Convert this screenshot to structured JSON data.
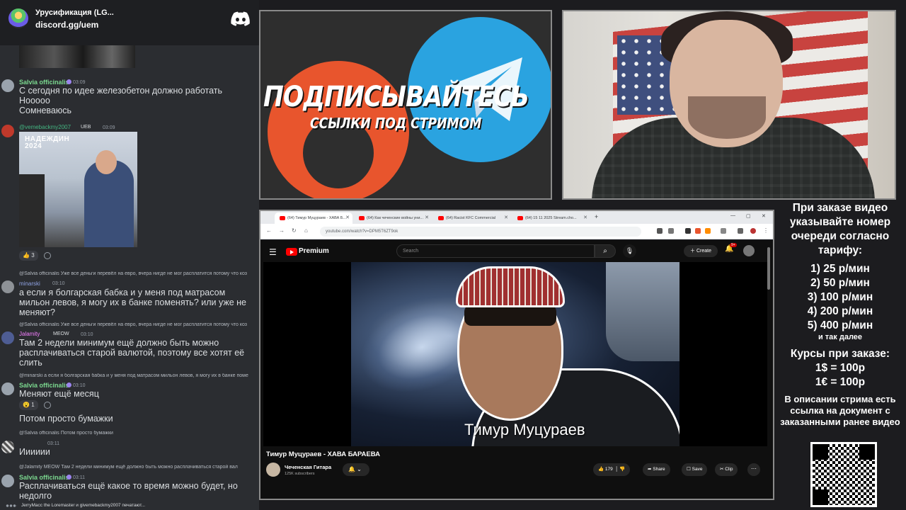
{
  "chat": {
    "server_name": "Урусификация (LG...",
    "invite": "discord.gg/uem",
    "messages": [
      {
        "user": "Salvia officinalis",
        "time": "03:09",
        "lines": "С сегодня по идее железобетон должно работать\nНооооо\nСомневаюсь",
        "color": "#7bd88f"
      },
      {
        "user": "@vemebackmy2007",
        "tag": "UEB",
        "time": "03:09",
        "color": "#43b581"
      },
      {
        "image_caption": "НАДЕЖДИН\n2024",
        "reaction": "3"
      },
      {
        "reply": "@Salvia officinalis Уже все деньги перевёл на евро, вчера нигде не мог расплатится потому что коз",
        "user": "minarski",
        "time": "03:10",
        "lines": "а если я болгарская бабка и у меня под матрасом\nмильон левов, я могу их в банке поменять? или уже не\nменяют?",
        "color": "#5865f2"
      },
      {
        "reply": "@Salvia officinalis Уже все деньги перевёл на евро, вчера нигде не мог расплатится потому что коз",
        "user": "Jalamity",
        "tag": "MEOW",
        "time": "03:10",
        "lines": "Там 2 недели минимум ещё должно быть можно\nрасплачиваться старой валютой, поэтому все хотят её\nслить",
        "color": "#f47fff"
      },
      {
        "reply": "@minarski а если я болгарская бабка и у меня под матрасом мильон левов, я могу их в банке поме",
        "user": "Salvia officinalis",
        "time": "03:10",
        "lines": "Меняют ещё месяц",
        "reaction": "1",
        "extra": "Потом просто бумажки",
        "color": "#7bd88f"
      },
      {
        "reply": "@Salvia officinalis Потом просто бумажки",
        "time": "03:11",
        "lines": "Ииииии"
      },
      {
        "reply": "@Jalamity MEOW Там 2 недели минимум ещё должно быть можно расплачиваться старой вал",
        "user": "Salvia officinalis",
        "time": "03:11",
        "lines": "Расплачиваться ещё какое то время можно будет, но\nнедолго",
        "color": "#7bd88f"
      }
    ],
    "typing": "JerryMacc the Loremaster и givemebackmy2007 печатают..."
  },
  "promo": {
    "title": "ПОДПИСЫВАЙТЕСЬ",
    "subtitle": "ССЫЛКИ ПОД СТРИМОМ"
  },
  "browser": {
    "tabs": [
      {
        "label": "(64) Тимур Муцураев - ХАВА Б..."
      },
      {
        "label": "(64) Как чеченские войны уни..."
      },
      {
        "label": "(64) Racist KFC Commercial"
      },
      {
        "label": "(64) 15 11 2025 Stream.cho..."
      }
    ],
    "url": "youtube.com/watch?v=DPM5T6ZT9ok"
  },
  "youtube": {
    "brand": "Premium",
    "search_placeholder": "Search",
    "create_label": "Create",
    "notif_count": "9+",
    "video_caption": "Тимур Муцураев",
    "video_title": "Тимур Муцураев - ХАВА БАРАЕВА",
    "channel_name": "Чеченская Гитара",
    "channel_subs": "125K subscribers",
    "likes": "179",
    "share_label": "Share",
    "save_label": "Save",
    "clip_label": "Clip"
  },
  "prices": {
    "intro": "При заказе видео указывайте номер очереди согласно тарифу:",
    "rates": [
      "1) 25 р/мин",
      "2) 50 р/мин",
      "3) 100 р/мин",
      "4) 200 р/мин",
      "5) 400 р/мин"
    ],
    "etc": "и так далее",
    "courses_title": "Курсы при заказе:",
    "course_usd": "1$ = 100р",
    "course_eur": "1€ = 100р",
    "description": "В описании стрима есть ссылка на документ с заказанными ранее видео"
  },
  "colors": {
    "discord_bg": "#2b2d31",
    "boosty": "#e8552d",
    "telegram": "#2aa3e0",
    "youtube_red": "#ff0000"
  }
}
